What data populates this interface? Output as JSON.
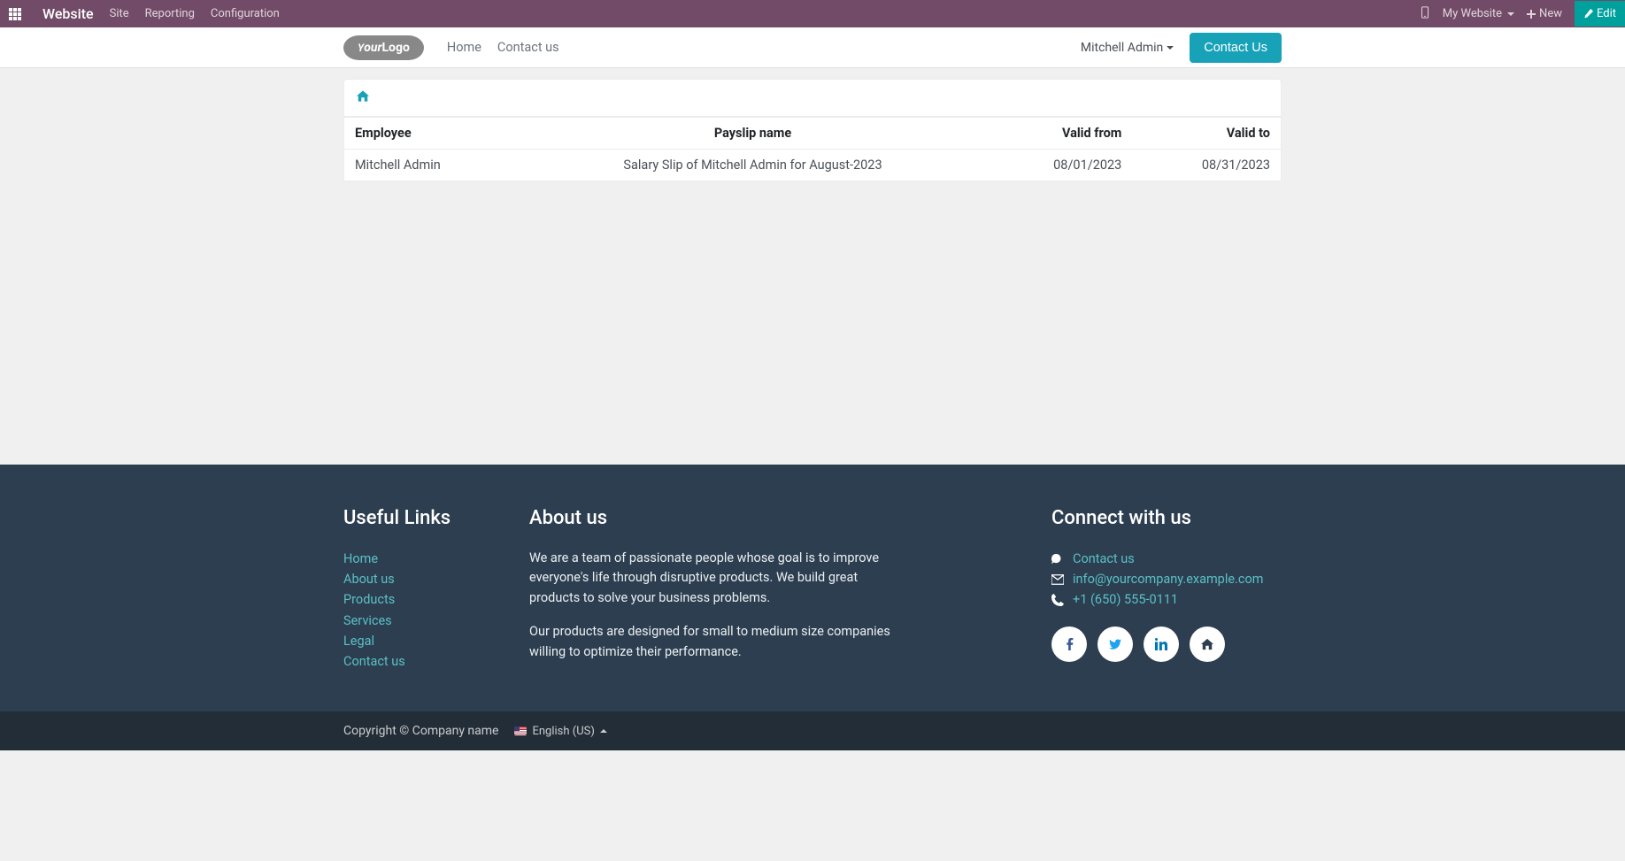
{
  "admin": {
    "brand": "Website",
    "menu": [
      "Site",
      "Reporting",
      "Configuration"
    ],
    "mywebsite": "My Website",
    "new": "New",
    "edit": "Edit"
  },
  "nav": {
    "logo": "YourLogo",
    "links": [
      "Home",
      "Contact us"
    ],
    "user": "Mitchell Admin",
    "contact": "Contact Us"
  },
  "table": {
    "headers": {
      "employee": "Employee",
      "payslip": "Payslip name",
      "from": "Valid from",
      "to": "Valid to"
    },
    "rows": [
      {
        "employee": "Mitchell Admin",
        "payslip": "Salary Slip of Mitchell Admin for August-2023",
        "from": "08/01/2023",
        "to": "08/31/2023"
      }
    ]
  },
  "footer": {
    "useful": {
      "title": "Useful Links",
      "items": [
        "Home",
        "About us",
        "Products",
        "Services",
        "Legal",
        "Contact us"
      ]
    },
    "about": {
      "title": "About us",
      "p1": "We are a team of passionate people whose goal is to improve everyone's life through disruptive products. We build great products to solve your business problems.",
      "p2": "Our products are designed for small to medium size companies willing to optimize their performance."
    },
    "connect": {
      "title": "Connect with us",
      "contact": "Contact us",
      "email": "info@yourcompany.example.com",
      "phone": "+1 (650) 555-0111"
    }
  },
  "sub": {
    "copyright": "Copyright © Company name",
    "lang": "English (US)"
  }
}
